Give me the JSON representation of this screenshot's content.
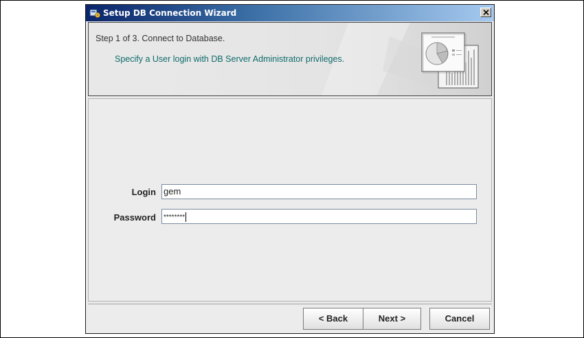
{
  "window": {
    "title": "Setup DB Connection Wizard",
    "close_glyph": "✕"
  },
  "header": {
    "step": "Step 1 of 3. Connect to Database.",
    "description": "Specify a User login with DB Server Administrator privileges."
  },
  "form": {
    "login_label": "Login",
    "login_value": "gem",
    "password_label": "Password",
    "password_value": "********"
  },
  "buttons": {
    "back": "< Back",
    "next": "Next >",
    "cancel": "Cancel"
  },
  "colors": {
    "title_bar": "#0a246a",
    "description_text": "#0f6b6b",
    "panel_bg": "#ececec"
  },
  "icons": {
    "window_icon": "wizard-icon",
    "close": "close-icon",
    "header_graphic": "chart-report-icon"
  }
}
